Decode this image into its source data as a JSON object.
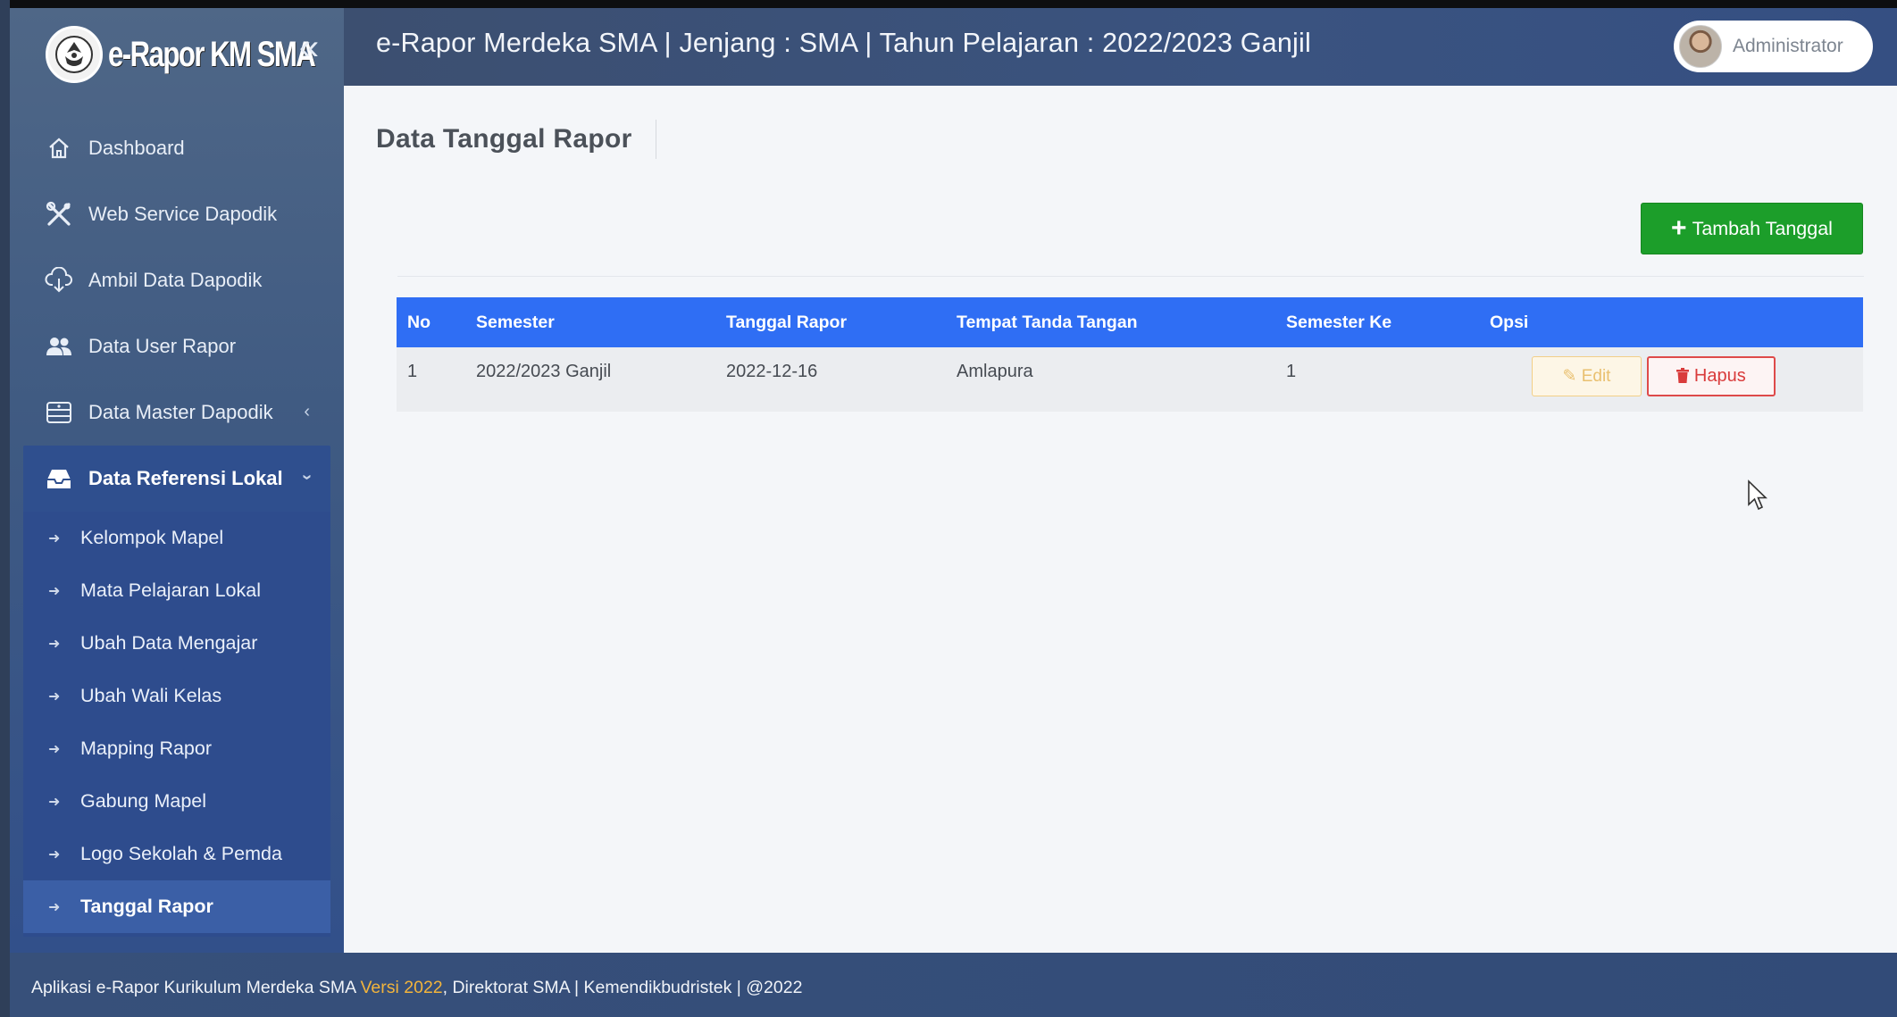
{
  "app": {
    "brand": "e-Rapor KM SMA",
    "header_title": "e-Rapor Merdeka SMA | Jenjang : SMA | Tahun Pelajaran : 2022/2023 Ganjil",
    "user_name": "Administrator"
  },
  "sidebar": {
    "items": [
      {
        "label": "Dashboard",
        "icon": "home-icon"
      },
      {
        "label": "Web Service Dapodik",
        "icon": "tools-icon"
      },
      {
        "label": "Ambil Data Dapodik",
        "icon": "cloud-download-icon"
      },
      {
        "label": "Data User Rapor",
        "icon": "users-icon"
      },
      {
        "label": "Data Master Dapodik",
        "icon": "database-icon"
      },
      {
        "label": "Data Referensi Lokal",
        "icon": "inbox-icon"
      }
    ],
    "sub_items": [
      {
        "label": "Kelompok Mapel"
      },
      {
        "label": "Mata Pelajaran Lokal"
      },
      {
        "label": "Ubah Data Mengajar"
      },
      {
        "label": "Ubah Wali Kelas"
      },
      {
        "label": "Mapping Rapor"
      },
      {
        "label": "Gabung Mapel"
      },
      {
        "label": "Logo Sekolah & Pemda"
      },
      {
        "label": "Tanggal Rapor"
      }
    ]
  },
  "page": {
    "title": "Data Tanggal Rapor",
    "add_button": "Tambah Tanggal"
  },
  "table": {
    "headers": [
      "No",
      "Semester",
      "Tanggal Rapor",
      "Tempat Tanda Tangan",
      "Semester Ke",
      "Opsi"
    ],
    "rows": [
      {
        "no": "1",
        "semester": "2022/2023 Ganjil",
        "tanggal": "2022-12-16",
        "tempat": "Amlapura",
        "semester_ke": "1",
        "edit": "Edit",
        "hapus": "Hapus"
      }
    ]
  },
  "footer": {
    "pre": "Aplikasi e-Rapor Kurikulum Merdeka SMA ",
    "version": "Versi 2022",
    "post": ", Direktorat SMA | Kemendikbudristek | @2022"
  },
  "colors": {
    "accent": "#2f6ef4",
    "success": "#1c9e2a",
    "danger": "#d93b3b",
    "warning": "#e9c070"
  }
}
